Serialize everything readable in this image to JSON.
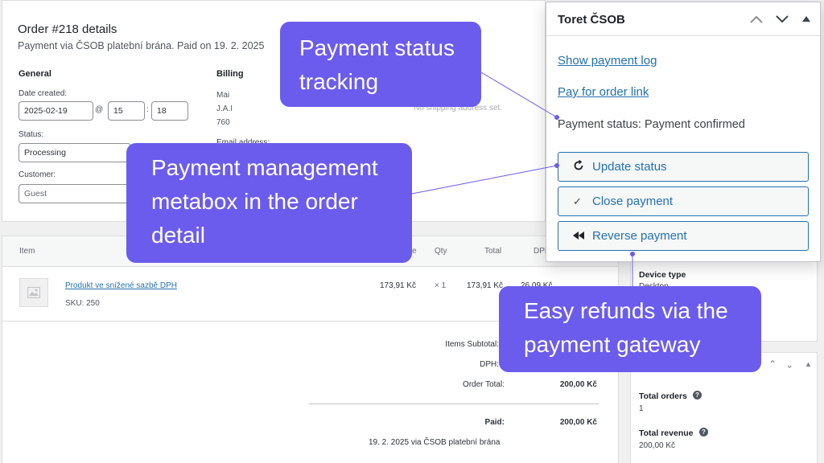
{
  "order": {
    "title": "Order #218 details",
    "subtitle": "Payment via ČSOB platební brána. Paid on 19. 2. 2025",
    "general_heading": "General",
    "date_label": "Date created:",
    "date_value": "2025-02-19",
    "at_sign": "@",
    "hour_value": "15",
    "colon": ":",
    "minute_value": "18",
    "status_label": "Status:",
    "status_value": "Processing",
    "customer_label": "Customer:",
    "customer_value": "Guest",
    "billing_heading": "Billing",
    "billing_line1": "Mai",
    "billing_line2": "J.A.I",
    "billing_line3": "760",
    "email_label": "Email address:",
    "shipping_note": "No shipping address set."
  },
  "items": {
    "headers": {
      "item": "Item",
      "cost_partial": "e",
      "qty": "Qty",
      "total": "Total",
      "tax": "DPH"
    },
    "rows": [
      {
        "name": "Produkt ve snížené sazbě DPH",
        "sku": "SKU: 250",
        "cost": "173,91 Kč",
        "qty": "× 1",
        "total": "173,91 Kč",
        "tax": "26,09 Kč"
      }
    ],
    "totals": {
      "subtotal_label": "Items Subtotal:",
      "tax_label": "DPH:",
      "order_total_label": "Order Total:",
      "order_total_value": "200,00 Kč",
      "paid_label": "Paid:",
      "paid_value": "200,00 Kč",
      "paid_note": "19. 2. 2025 via ČSOB platební brána"
    }
  },
  "metabox": {
    "title": "Toret ČSOB",
    "show_log": "Show payment log",
    "pay_link": "Pay for order link",
    "status_text": "Payment status: Payment confirmed",
    "buttons": {
      "update": "Update status",
      "close": "Close payment",
      "reverse": "Reverse payment"
    }
  },
  "sidebar": {
    "device_type_label": "Device type",
    "device_type_value": "Desktop",
    "total_orders_label": "Total orders",
    "total_orders_value": "1",
    "total_revenue_label": "Total revenue",
    "total_revenue_value": "200,00 Kč"
  },
  "callouts": {
    "status_tracking": [
      "Payment status",
      "tracking"
    ],
    "management": [
      "Payment management",
      "metabox in the order",
      "detail"
    ],
    "refunds": [
      "Easy refunds via the",
      "payment gateway"
    ]
  },
  "colors": {
    "accent": "#2271b1",
    "callout": "#6b5ced",
    "callout_line": "#6b5ced"
  }
}
